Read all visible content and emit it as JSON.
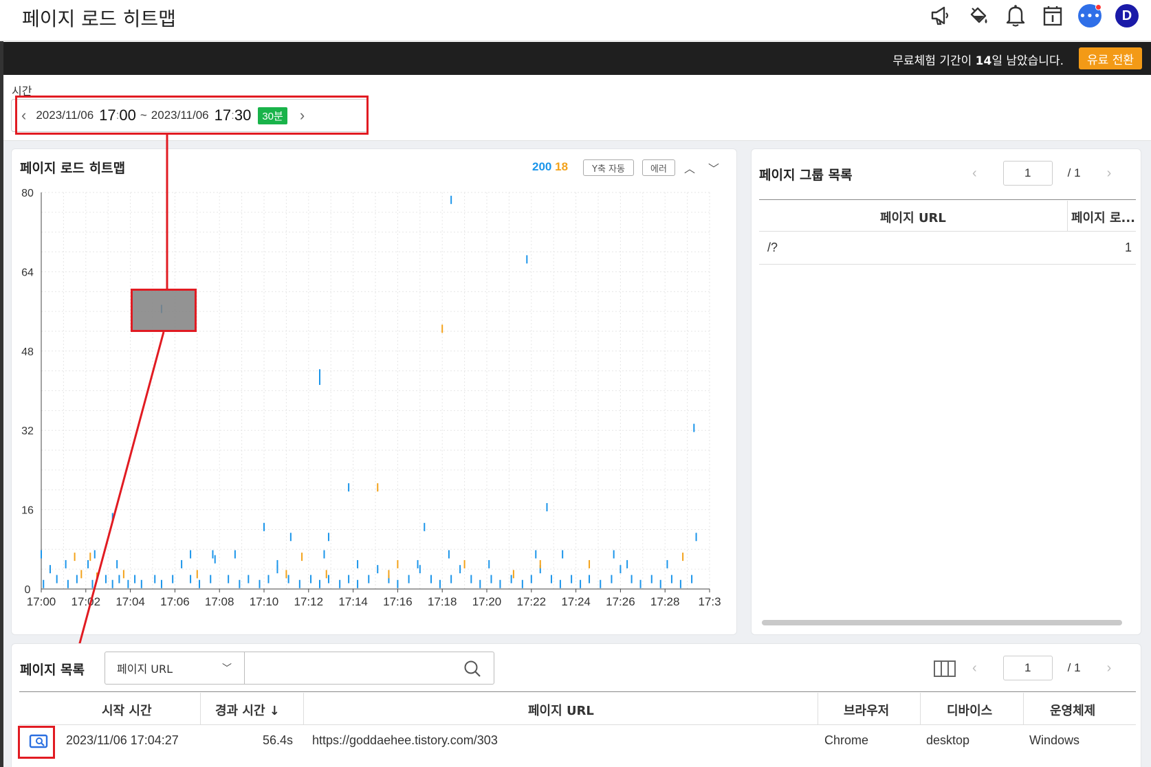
{
  "header": {
    "title": "페이지 로드 히트맵",
    "avatar_initial": "D",
    "icons": [
      "megaphone-icon",
      "paint-bucket-icon",
      "bell-icon",
      "calendar-icon",
      "chat-icon"
    ]
  },
  "trial": {
    "text_before": "무료체험 기간이 ",
    "days": "14",
    "text_after": "일 남았습니다.",
    "button": "유료 전환"
  },
  "time": {
    "label": "시간",
    "start_date": "2023/11/06",
    "start_hour": "17",
    "start_min": "00",
    "sep": "~",
    "end_date": "2023/11/06",
    "end_hour": "17",
    "end_min": "30",
    "duration": "30분"
  },
  "heatmap": {
    "title": "페이지 로드 히트맵",
    "count_normal": "200",
    "count_error": "18",
    "y_auto_chip": "Y축 자동",
    "error_chip": "에러",
    "colors": {
      "normal": "#1b95ea",
      "error": "#f3a21a"
    }
  },
  "chart_data": {
    "type": "scatter",
    "title": "페이지 로드 히트맵",
    "xlabel": "",
    "ylabel": "",
    "xlim": [
      0,
      30
    ],
    "ylim": [
      0,
      80
    ],
    "y_ticks": [
      "0",
      "16",
      "32",
      "48",
      "64",
      "80"
    ],
    "x_ticks": [
      "17:00",
      "17:02",
      "17:04",
      "17:06",
      "17:08",
      "17:10",
      "17:12",
      "17:14",
      "17:16",
      "17:18",
      "17:20",
      "17:22",
      "17:24",
      "17:26",
      "17:28",
      "17:3"
    ],
    "series": [
      {
        "name": "200",
        "color": "#1b95ea",
        "points": [
          [
            0.1,
            1
          ],
          [
            0.4,
            4
          ],
          [
            0.7,
            2
          ],
          [
            1.2,
            1
          ],
          [
            1.6,
            2
          ],
          [
            2.1,
            5
          ],
          [
            2.3,
            1
          ],
          [
            2.9,
            2
          ],
          [
            3.2,
            1
          ],
          [
            3.5,
            2
          ],
          [
            3.9,
            1
          ],
          [
            4.2,
            2
          ],
          [
            4.5,
            1
          ],
          [
            5.1,
            2
          ],
          [
            5.4,
            1
          ],
          [
            5.9,
            2
          ],
          [
            6.3,
            5
          ],
          [
            6.7,
            2
          ],
          [
            7.1,
            1
          ],
          [
            7.6,
            2
          ],
          [
            7.8,
            6
          ],
          [
            8.4,
            2
          ],
          [
            8.9,
            1
          ],
          [
            9.3,
            2
          ],
          [
            9.8,
            1
          ],
          [
            10.2,
            2
          ],
          [
            10.6,
            4
          ],
          [
            11.1,
            2
          ],
          [
            11.6,
            1
          ],
          [
            12.1,
            2
          ],
          [
            12.5,
            1
          ],
          [
            12.9,
            2
          ],
          [
            13.4,
            1
          ],
          [
            13.8,
            2
          ],
          [
            14.2,
            1
          ],
          [
            14.7,
            2
          ],
          [
            15.1,
            4
          ],
          [
            15.6,
            2
          ],
          [
            16.0,
            1
          ],
          [
            16.5,
            2
          ],
          [
            17.0,
            4
          ],
          [
            17.5,
            2
          ],
          [
            17.9,
            1
          ],
          [
            18.4,
            2
          ],
          [
            18.8,
            4
          ],
          [
            19.3,
            2
          ],
          [
            19.7,
            1
          ],
          [
            20.2,
            2
          ],
          [
            20.6,
            1
          ],
          [
            21.1,
            2
          ],
          [
            21.6,
            1
          ],
          [
            22.0,
            2
          ],
          [
            22.4,
            4
          ],
          [
            22.9,
            2
          ],
          [
            23.3,
            1
          ],
          [
            23.8,
            2
          ],
          [
            24.2,
            1
          ],
          [
            24.6,
            2
          ],
          [
            25.1,
            1
          ],
          [
            25.6,
            2
          ],
          [
            26.0,
            4
          ],
          [
            26.5,
            2
          ],
          [
            26.9,
            1
          ],
          [
            27.4,
            2
          ],
          [
            27.8,
            1
          ],
          [
            28.3,
            2
          ],
          [
            28.7,
            1
          ],
          [
            29.2,
            2
          ],
          [
            0.0,
            7
          ],
          [
            1.1,
            5
          ],
          [
            2.4,
            7
          ],
          [
            3.4,
            5
          ],
          [
            6.7,
            7
          ],
          [
            7.7,
            7
          ],
          [
            8.7,
            7
          ],
          [
            10.6,
            5
          ],
          [
            12.7,
            7
          ],
          [
            14.2,
            5
          ],
          [
            16.9,
            5
          ],
          [
            18.3,
            7
          ],
          [
            20.1,
            5
          ],
          [
            22.2,
            7
          ],
          [
            23.4,
            7
          ],
          [
            25.7,
            7
          ],
          [
            26.3,
            5
          ],
          [
            28.1,
            5
          ],
          [
            3.2,
            14.5
          ],
          [
            10.0,
            12.5
          ],
          [
            11.2,
            10.5
          ],
          [
            12.9,
            10.5
          ],
          [
            17.2,
            12.5
          ],
          [
            22.7,
            16.5
          ],
          [
            29.4,
            10.5
          ],
          [
            29.3,
            32.5
          ],
          [
            12.5,
            43.5
          ],
          [
            12.5,
            42
          ],
          [
            13.8,
            20.5
          ],
          [
            18.4,
            78.5
          ],
          [
            21.8,
            66.5
          ],
          [
            5.4,
            56.5
          ]
        ]
      },
      {
        "name": "18",
        "color": "#f3a21a",
        "points": [
          [
            1.5,
            6.5
          ],
          [
            1.8,
            3
          ],
          [
            2.2,
            6.5
          ],
          [
            2.5,
            2.5
          ],
          [
            3.7,
            3
          ],
          [
            7.0,
            3
          ],
          [
            11.0,
            3
          ],
          [
            11.7,
            6.5
          ],
          [
            12.8,
            3
          ],
          [
            15.6,
            3
          ],
          [
            16.0,
            5
          ],
          [
            19.0,
            5
          ],
          [
            21.2,
            3
          ],
          [
            22.4,
            5
          ],
          [
            24.6,
            5
          ],
          [
            28.8,
            6.5
          ],
          [
            18.0,
            52.5
          ],
          [
            15.1,
            20.5
          ]
        ]
      }
    ]
  },
  "group_list": {
    "title": "페이지 그룹 목록",
    "page": "1",
    "total": "/ 1",
    "columns": [
      "페이지 URL",
      "페이지 로..."
    ],
    "rows": [
      {
        "url": "/?",
        "count": "1"
      }
    ]
  },
  "page_list": {
    "title": "페이지 목록",
    "filter_select": "페이지 URL",
    "search_placeholder": "",
    "page": "1",
    "total": "/ 1",
    "columns": [
      "시작 시간",
      "경과 시간",
      "페이지 URL",
      "브라우저",
      "디바이스",
      "운영체제"
    ],
    "sort_indicator": "↓",
    "rows": [
      {
        "start": "2023/11/06 17:04:27",
        "elapsed": "56.4s",
        "url": "https://goddaehee.tistory.com/303",
        "browser": "Chrome",
        "device": "desktop",
        "os": "Windows"
      }
    ]
  }
}
